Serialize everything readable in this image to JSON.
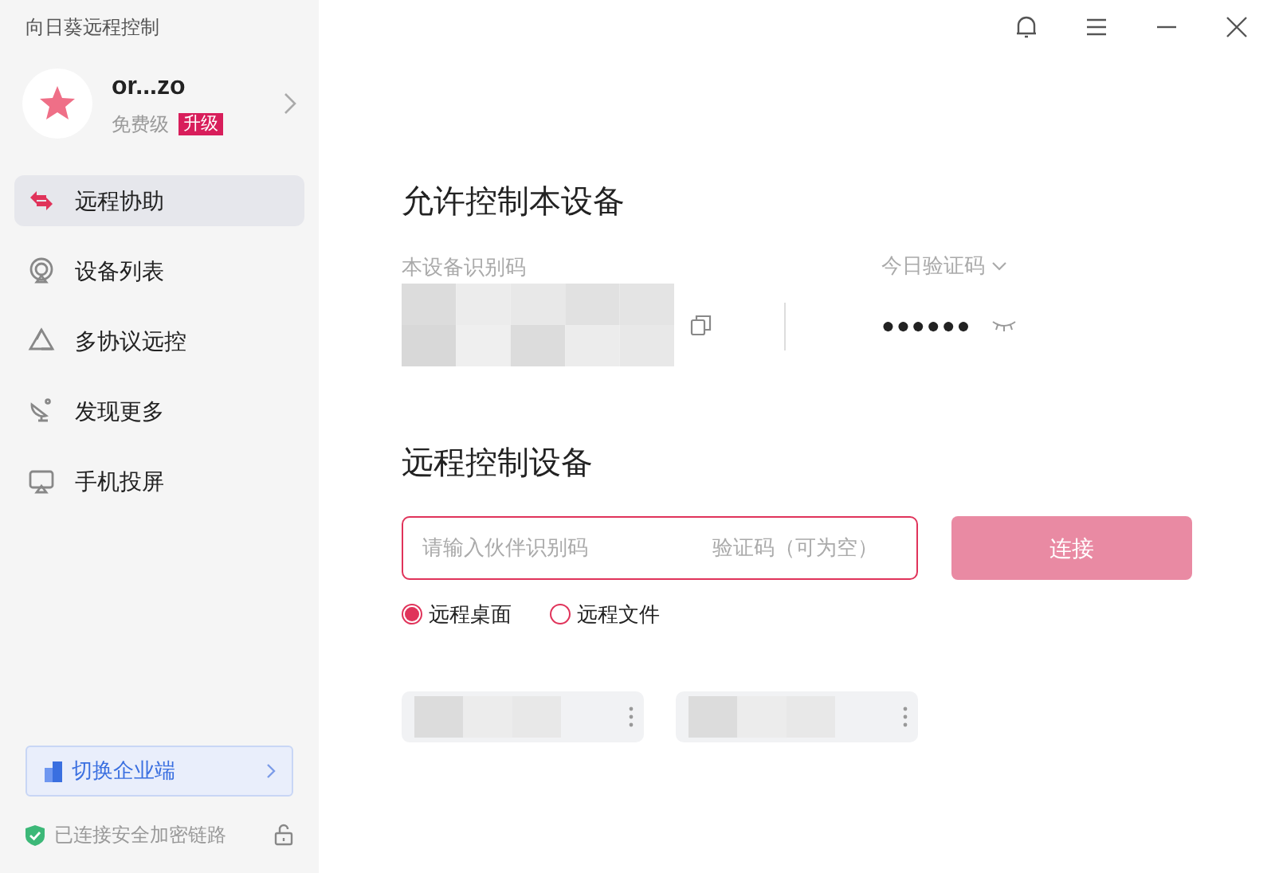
{
  "app_title": "向日葵远程控制",
  "account": {
    "name": "or...zo",
    "tier": "免费级",
    "upgrade": "升级"
  },
  "sidebar": {
    "items": [
      {
        "kind": "assist",
        "label": "远程协助",
        "selected": true
      },
      {
        "kind": "devices",
        "label": "设备列表",
        "selected": false
      },
      {
        "kind": "protocol",
        "label": "多协议远控",
        "selected": false
      },
      {
        "kind": "discover",
        "label": "发现更多",
        "selected": false
      },
      {
        "kind": "mirror",
        "label": "手机投屏",
        "selected": false
      }
    ]
  },
  "enterprise_button": "切换企业端",
  "security_status": "已连接安全加密链路",
  "allow_section": {
    "title": "允许控制本设备",
    "id_label": "本设备识别码",
    "code_label": "今日验证码",
    "code_value": "●●●●●●"
  },
  "remote_section": {
    "title": "远程控制设备",
    "partner_placeholder": "请输入伙伴识别码",
    "code_placeholder": "验证码（可为空）",
    "connect": "连接",
    "modes": [
      {
        "label": "远程桌面",
        "selected": true
      },
      {
        "label": "远程文件",
        "selected": false
      }
    ]
  }
}
